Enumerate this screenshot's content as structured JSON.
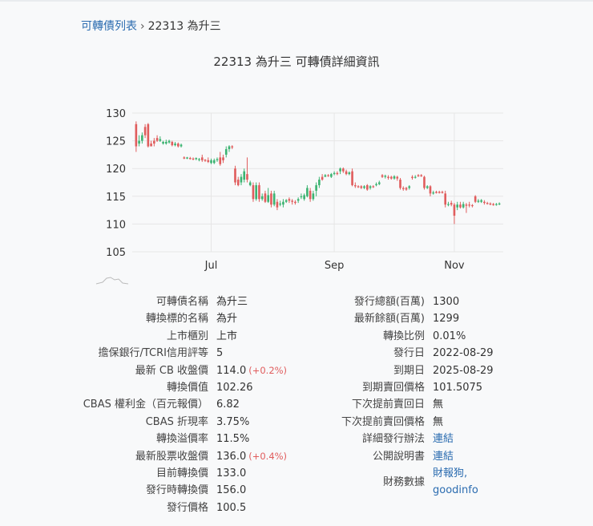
{
  "breadcrumb": {
    "list_link": "可轉債列表",
    "separator": "›",
    "current": "22313 為升三"
  },
  "page_title": "22313 可轉債詳細資訊",
  "page_title_prefix": "22313 為升三 可轉債詳細資訊",
  "colors": {
    "up": "#e05d5d",
    "down": "#3cb371",
    "link": "#2b6cb0",
    "grid": "#e6e6e6"
  },
  "chart_data": {
    "type": "candlestick",
    "ylim": [
      105,
      130
    ],
    "yticks": [
      105,
      110,
      115,
      120,
      125,
      130
    ],
    "xticks": [
      {
        "label": "Jul",
        "index": 25
      },
      {
        "label": "Sep",
        "index": 66
      },
      {
        "label": "Nov",
        "index": 106
      }
    ],
    "candles": [
      [
        128.0,
        124.0,
        128.5,
        123.0
      ],
      [
        124.5,
        125.0,
        126.0,
        124.0
      ],
      [
        125.0,
        126.0,
        126.5,
        124.5
      ],
      [
        127.5,
        126.0,
        128.0,
        125.5
      ],
      [
        128.0,
        124.0,
        128.2,
        123.8
      ],
      [
        124.5,
        124.0,
        125.0,
        124.0
      ],
      [
        125.0,
        124.5,
        125.5,
        124.0
      ],
      [
        125.5,
        125.0,
        126.0,
        124.8
      ],
      [
        125.0,
        125.3,
        125.8,
        124.8
      ],
      [
        124.5,
        124.8,
        125.0,
        124.3
      ],
      [
        124.5,
        124.8,
        125.2,
        124.3
      ],
      [
        124.7,
        125.0,
        125.2,
        124.5
      ],
      [
        124.8,
        124.2,
        125.0,
        124.0
      ],
      [
        124.2,
        124.5,
        124.8,
        124.0
      ],
      [
        124.5,
        124.0,
        124.7,
        123.8
      ],
      [
        124.0,
        124.3,
        124.5,
        123.8
      ],
      [
        122.0,
        121.8,
        122.2,
        121.7
      ],
      [
        121.8,
        122.0,
        122.1,
        121.7
      ],
      [
        121.9,
        121.8,
        122.1,
        121.6
      ],
      [
        121.8,
        121.7,
        122.0,
        121.5
      ],
      [
        121.7,
        121.9,
        122.0,
        121.5
      ],
      [
        121.6,
        121.7,
        121.9,
        121.3
      ],
      [
        122.0,
        121.5,
        122.5,
        121.2
      ],
      [
        121.6,
        121.4,
        121.7,
        121.2
      ],
      [
        121.5,
        121.2,
        122.0,
        121.0
      ],
      [
        121.0,
        121.5,
        121.8,
        120.8
      ],
      [
        121.0,
        121.5,
        121.8,
        120.8
      ],
      [
        121.5,
        121.7,
        122.0,
        121.2
      ],
      [
        122.0,
        120.8,
        123.0,
        120.5
      ],
      [
        122.0,
        121.5,
        122.5,
        121.0
      ],
      [
        122.5,
        123.5,
        124.0,
        122.0
      ],
      [
        123.5,
        124.0,
        124.2,
        123.0
      ],
      [
        124.0,
        123.8,
        124.2,
        123.5
      ],
      [
        120.0,
        117.5,
        120.5,
        117.0
      ],
      [
        118.0,
        117.0,
        118.5,
        116.8
      ],
      [
        117.5,
        118.5,
        119.0,
        117.0
      ],
      [
        118.0,
        119.5,
        120.0,
        117.5
      ],
      [
        119.0,
        118.0,
        122.0,
        117.5
      ],
      [
        117.0,
        117.5,
        117.8,
        116.8
      ],
      [
        117.0,
        114.5,
        117.5,
        114.0
      ],
      [
        114.5,
        117.0,
        117.5,
        114.2
      ],
      [
        117.0,
        114.5,
        117.5,
        114.0
      ],
      [
        114.5,
        115.0,
        115.5,
        114.2
      ],
      [
        115.5,
        114.0,
        116.0,
        113.8
      ],
      [
        114.0,
        115.2,
        116.5,
        113.8
      ],
      [
        115.5,
        113.5,
        116.0,
        113.0
      ],
      [
        113.5,
        115.5,
        116.0,
        113.2
      ],
      [
        114.0,
        113.0,
        114.5,
        112.5
      ],
      [
        113.5,
        113.7,
        114.2,
        113.2
      ],
      [
        113.5,
        114.0,
        114.5,
        113.0
      ],
      [
        114.0,
        114.3,
        114.5,
        113.8
      ],
      [
        114.5,
        114.2,
        114.8,
        113.8
      ],
      [
        114.2,
        114.0,
        114.5,
        113.5
      ],
      [
        114.0,
        113.8,
        114.3,
        113.5
      ],
      [
        114.2,
        114.5,
        114.8,
        113.8
      ],
      [
        115.0,
        115.0,
        115.5,
        114.5
      ],
      [
        114.5,
        115.2,
        115.5,
        114.2
      ],
      [
        115.0,
        116.5,
        117.0,
        114.8
      ],
      [
        116.0,
        114.5,
        116.5,
        114.0
      ],
      [
        114.5,
        115.5,
        116.0,
        114.2
      ],
      [
        116.0,
        117.0,
        117.5,
        115.0
      ],
      [
        117.0,
        118.0,
        118.5,
        116.5
      ],
      [
        118.5,
        118.0,
        119.0,
        117.8
      ],
      [
        118.5,
        118.8,
        119.0,
        118.5
      ],
      [
        118.8,
        118.7,
        119.0,
        118.5
      ],
      [
        118.5,
        119.0,
        119.2,
        118.3
      ],
      [
        119.0,
        119.2,
        119.5,
        118.8
      ],
      [
        119.2,
        119.0,
        119.5,
        118.8
      ],
      [
        119.5,
        120.0,
        120.2,
        119.0
      ],
      [
        120.0,
        119.5,
        120.2,
        119.2
      ],
      [
        119.5,
        119.0,
        119.8,
        118.8
      ],
      [
        119.0,
        119.3,
        119.5,
        118.8
      ],
      [
        119.5,
        117.0,
        120.0,
        116.8
      ],
      [
        117.0,
        116.8,
        117.5,
        116.5
      ],
      [
        116.8,
        116.7,
        117.0,
        116.5
      ],
      [
        116.8,
        116.5,
        117.0,
        116.3
      ],
      [
        116.5,
        116.8,
        117.0,
        116.3
      ],
      [
        117.0,
        116.2,
        117.2,
        116.0
      ],
      [
        116.5,
        116.8,
        117.0,
        116.2
      ],
      [
        116.8,
        116.7,
        117.0,
        116.5
      ],
      [
        117.0,
        117.2,
        117.5,
        116.8
      ],
      [
        117.2,
        117.5,
        117.8,
        117.0
      ],
      [
        118.8,
        118.5,
        119.0,
        118.3
      ],
      [
        118.5,
        118.7,
        118.9,
        118.2
      ],
      [
        118.5,
        118.3,
        118.8,
        118.0
      ],
      [
        118.5,
        118.2,
        118.7,
        118.0
      ],
      [
        118.2,
        118.6,
        118.8,
        118.0
      ],
      [
        118.5,
        118.2,
        118.7,
        117.8
      ],
      [
        118.0,
        116.5,
        118.3,
        116.2
      ],
      [
        116.5,
        116.3,
        116.8,
        116.0
      ],
      [
        116.5,
        116.2,
        116.7,
        116.0
      ],
      [
        116.5,
        116.8,
        117.0,
        116.2
      ],
      [
        118.5,
        118.3,
        118.8,
        118.0
      ],
      [
        118.5,
        118.5,
        118.8,
        118.2
      ],
      [
        118.8,
        118.6,
        119.0,
        118.5
      ],
      [
        118.8,
        118.6,
        119.0,
        118.5
      ],
      [
        118.5,
        116.5,
        118.7,
        116.2
      ],
      [
        116.5,
        116.8,
        117.0,
        116.3
      ],
      [
        116.8,
        115.5,
        117.0,
        115.0
      ],
      [
        115.5,
        115.7,
        116.0,
        115.3
      ],
      [
        115.8,
        115.6,
        116.0,
        115.5
      ],
      [
        115.8,
        115.6,
        116.0,
        115.5
      ],
      [
        115.8,
        115.6,
        116.0,
        115.5
      ],
      [
        115.5,
        113.5,
        116.0,
        113.0
      ],
      [
        113.5,
        113.6,
        114.0,
        113.2
      ],
      [
        113.8,
        113.5,
        114.2,
        113.2
      ],
      [
        113.5,
        111.5,
        113.8,
        110.0
      ],
      [
        113.0,
        113.5,
        114.0,
        112.5
      ],
      [
        113.5,
        113.0,
        114.0,
        112.8
      ],
      [
        113.0,
        113.6,
        114.0,
        112.8
      ],
      [
        113.5,
        113.3,
        113.8,
        112.0
      ],
      [
        113.5,
        113.4,
        114.0,
        113.0
      ],
      [
        113.4,
        113.3,
        113.6,
        113.0
      ],
      [
        115.0,
        114.0,
        115.2,
        113.8
      ],
      [
        114.0,
        114.2,
        114.5,
        113.8
      ],
      [
        114.0,
        114.3,
        114.5,
        113.8
      ],
      [
        114.0,
        113.8,
        114.3,
        113.5
      ],
      [
        113.8,
        113.7,
        114.0,
        113.5
      ],
      [
        113.7,
        113.5,
        113.9,
        113.4
      ],
      [
        113.6,
        113.4,
        113.8,
        113.3
      ],
      [
        113.5,
        113.6,
        113.8,
        113.3
      ],
      [
        113.6,
        113.7,
        113.9,
        113.4
      ]
    ]
  },
  "left_table": [
    {
      "label": "可轉債名稱",
      "value": "為升三"
    },
    {
      "label": "轉換標的名稱",
      "value": "為升"
    },
    {
      "label": "上市櫃別",
      "value": "上市"
    },
    {
      "label": "擔保銀行/TCRI信用評等",
      "value": "5"
    },
    {
      "label": "最新 CB 收盤價",
      "value": "114.0",
      "change": "(+0.2%)"
    },
    {
      "label": "轉換價值",
      "value": "102.26"
    },
    {
      "label": "CBAS 權利金（百元報價）",
      "value": "6.82"
    },
    {
      "label": "CBAS 折現率",
      "value": "3.75%"
    },
    {
      "label": "轉換溢價率",
      "value": "11.5%"
    },
    {
      "label": "最新股票收盤價",
      "value": "136.0",
      "change": "(+0.4%)"
    },
    {
      "label": "目前轉換價",
      "value": "133.0"
    },
    {
      "label": "發行時轉換價",
      "value": "156.0"
    },
    {
      "label": "發行價格",
      "value": "100.5"
    }
  ],
  "right_table": [
    {
      "label": "發行總額(百萬)",
      "value": "1300"
    },
    {
      "label": "最新餘額(百萬)",
      "value": "1299"
    },
    {
      "label": "轉換比例",
      "value": "0.01%"
    },
    {
      "label": "發行日",
      "value": "2022-08-29"
    },
    {
      "label": "到期日",
      "value": "2025-08-29"
    },
    {
      "label": "到期賣回價格",
      "value": "101.5075"
    },
    {
      "label": "下次提前賣回日",
      "value": "無"
    },
    {
      "label": "下次提前賣回價格",
      "value": "無"
    },
    {
      "label": "詳細發行辦法",
      "link": "連結"
    },
    {
      "label": "公開說明書",
      "link": "連結"
    },
    {
      "label": "財務數據",
      "links": [
        "財報狗,",
        "goodinfo"
      ]
    }
  ]
}
